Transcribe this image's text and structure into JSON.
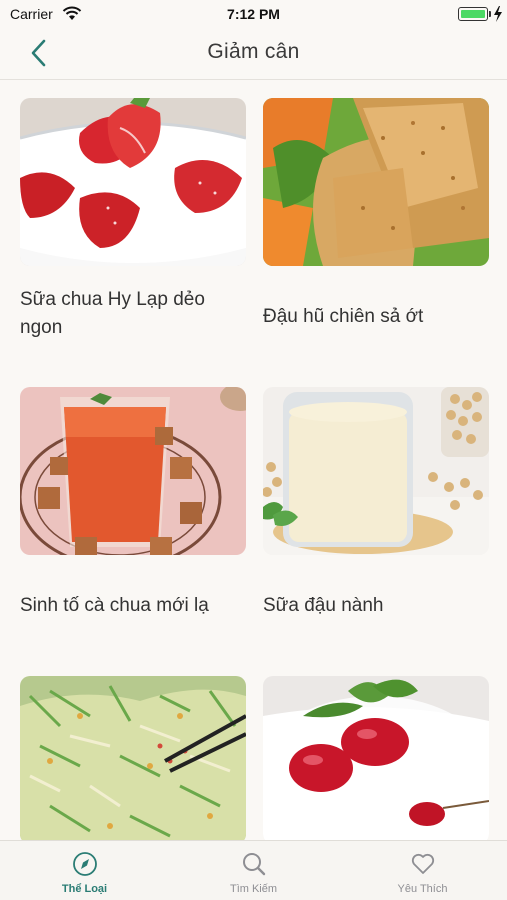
{
  "status_bar": {
    "carrier": "Carrier",
    "time": "7:12 PM"
  },
  "nav": {
    "title": "Giảm cân"
  },
  "recipes": [
    {
      "title": "Sữa chua Hy Lạp dẻo ngon"
    },
    {
      "title": "Đậu hũ chiên sả ớt"
    },
    {
      "title": "Sinh tố cà chua mới lạ"
    },
    {
      "title": "Sữa đậu nành"
    },
    {
      "title": ""
    },
    {
      "title": ""
    }
  ],
  "tabs": [
    {
      "label": "Thể Loại",
      "icon": "compass-icon",
      "active": true
    },
    {
      "label": "Tìm Kiếm",
      "icon": "search-icon",
      "active": false
    },
    {
      "label": "Yêu Thích",
      "icon": "heart-icon",
      "active": false
    }
  ],
  "colors": {
    "accent": "#2a7c74",
    "inactive": "#8e8e93",
    "background": "#faf8f5"
  }
}
